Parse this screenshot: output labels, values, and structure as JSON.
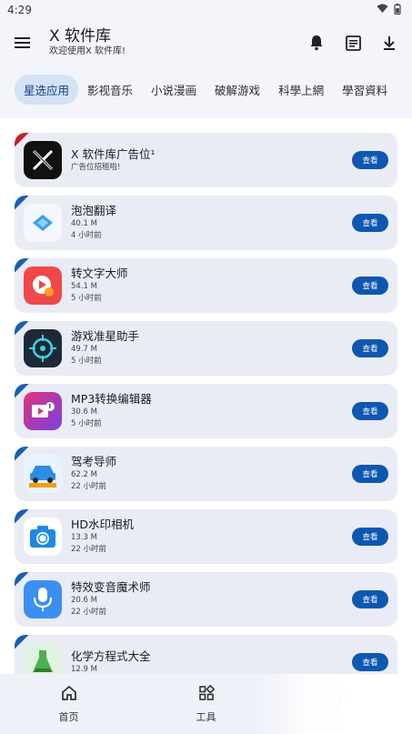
{
  "status": {
    "time": "4:29",
    "wifi_icon": "wifi-icon",
    "battery_icon": "battery-icon"
  },
  "header": {
    "title": "X 软件库",
    "subtitle": "欢迎使用X 软件库!",
    "menu_icon": "menu-icon",
    "bell_icon": "bell-icon",
    "notes_icon": "notes-icon",
    "download_icon": "download-icon"
  },
  "tabs": [
    {
      "label": "星选应用",
      "active": true
    },
    {
      "label": "影视音乐"
    },
    {
      "label": "小说漫画"
    },
    {
      "label": "破解游戏"
    },
    {
      "label": "科學上網"
    },
    {
      "label": "學習資料"
    }
  ],
  "apps": [
    {
      "name": "X 软件库广告位¹",
      "line1": "",
      "line2": "广告位招租啦!",
      "button": "查看",
      "ribbon": "#c71e2a",
      "icon_color": "#111111",
      "icon": "x-logo-icon"
    },
    {
      "name": "泡泡翻译",
      "line1": "40.1 M",
      "line2": "4 小时前",
      "button": "查看",
      "ribbon": "#1a5fb4",
      "icon_color": "#f4f7fb",
      "icon": "bubble-translate-icon"
    },
    {
      "name": "转文字大师",
      "line1": "54.1 M",
      "line2": "5 小时前",
      "button": "查看",
      "ribbon": "#1a5fb4",
      "icon_color": "#f0484a",
      "icon": "play-text-icon"
    },
    {
      "name": "游戏准星助手",
      "line1": "49.7 M",
      "line2": "5 小时前",
      "button": "查看",
      "ribbon": "#1a5fb4",
      "icon_color": "#1d2a36",
      "icon": "crosshair-icon"
    },
    {
      "name": "MP3转换编辑器",
      "line1": "30.6 M",
      "line2": "5 小时前",
      "button": "查看",
      "ribbon": "#1a5fb4",
      "icon_color": "#e0357a",
      "icon": "music-video-icon"
    },
    {
      "name": "驾考导师",
      "line1": "62.2 M",
      "line2": "22 小时前",
      "button": "查看",
      "ribbon": "#1a5fb4",
      "icon_color": "#2f8be6",
      "icon": "car-icon"
    },
    {
      "name": "HD水印相机",
      "line1": "13.3 M",
      "line2": "22 小时前",
      "button": "查看",
      "ribbon": "#1a5fb4",
      "icon_color": "#ffffff",
      "icon": "camera-icon"
    },
    {
      "name": "特效变音魔术师",
      "line1": "20.6 M",
      "line2": "22 小时前",
      "button": "查看",
      "ribbon": "#1a5fb4",
      "icon_color": "#3b8ff0",
      "icon": "microphone-icon"
    },
    {
      "name": "化学方程式大全",
      "line1": "12.9 M",
      "line2": "",
      "button": "查看",
      "ribbon": "#1a5fb4",
      "icon_color": "#4caf50",
      "icon": "flask-icon"
    }
  ],
  "bottom_nav": [
    {
      "label": "首页",
      "icon": "home-icon"
    },
    {
      "label": "工具",
      "icon": "tools-icon"
    },
    {
      "label": "",
      "icon": "profile-icon"
    }
  ]
}
